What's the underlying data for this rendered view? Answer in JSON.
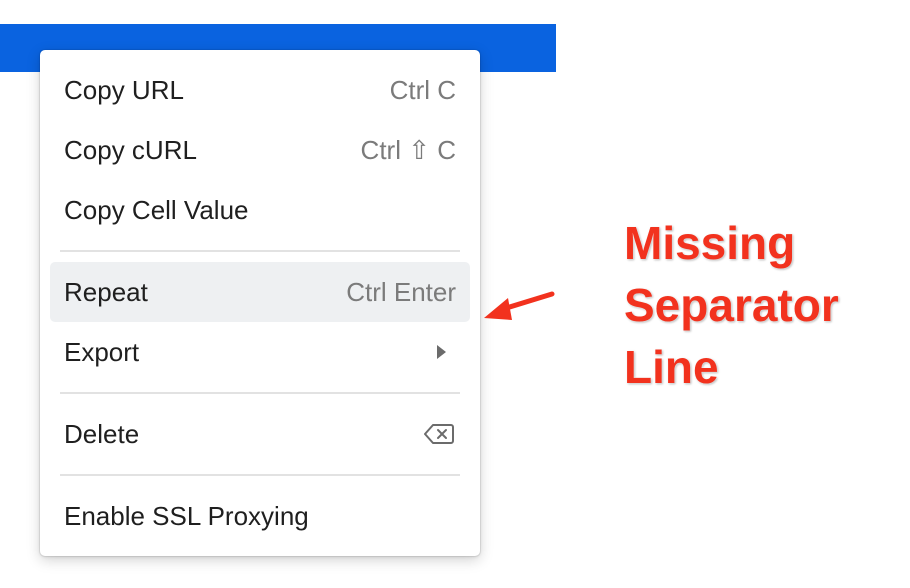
{
  "menu": {
    "items": [
      {
        "label": "Copy URL",
        "shortcut": "Ctrl C"
      },
      {
        "label": "Copy cURL",
        "shortcut": "Ctrl ⇧ C"
      },
      {
        "label": "Copy Cell Value",
        "shortcut": ""
      },
      {
        "label": "Repeat",
        "shortcut": "Ctrl Enter"
      },
      {
        "label": "Export",
        "icon": "submenu-arrow-icon"
      },
      {
        "label": "Delete",
        "icon": "backspace-icon"
      },
      {
        "label": "Enable SSL Proxying",
        "shortcut": ""
      }
    ]
  },
  "annotation": {
    "lines": [
      "Missing",
      "Separator",
      "Line"
    ],
    "color": "#f2321e"
  },
  "colors": {
    "header_bar": "#0a63e0",
    "highlight": "#eef0f2",
    "separator": "#e2e2e2",
    "shortcut_text": "#7b7b7b"
  }
}
